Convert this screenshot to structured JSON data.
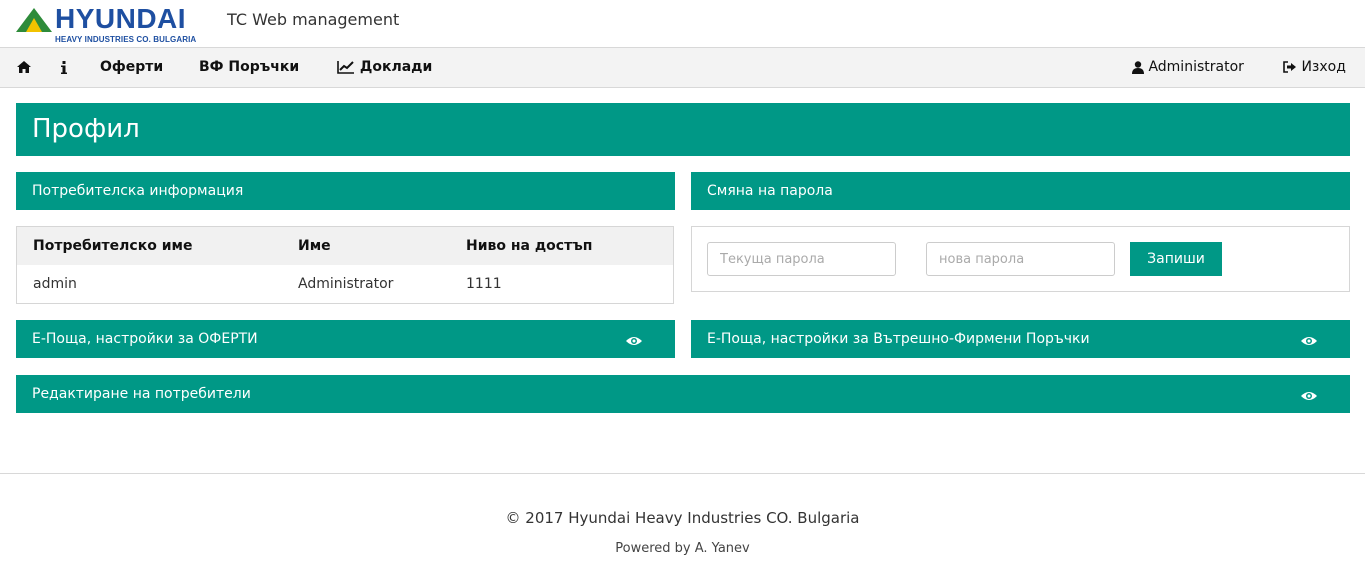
{
  "header": {
    "logo_text": "HYUNDAI",
    "logo_subtext": "HEAVY INDUSTRIES CO. BULGARIA",
    "app_title": "TC Web management",
    "brand_color": "#1e4fa1",
    "logo_accent_colors": [
      "#2e8b3a",
      "#f2c300"
    ]
  },
  "nav": {
    "home_icon": "home-icon",
    "info_icon": "info-icon",
    "offers": "Оферти",
    "orders": "ВФ Поръчки",
    "reports": "Доклади",
    "reports_icon": "line-chart-icon",
    "user": "Administrator",
    "user_icon": "user-icon",
    "logout": "Изход",
    "logout_icon": "logout-icon"
  },
  "page": {
    "title": "Профил",
    "accent_color": "#009886"
  },
  "user_info": {
    "heading": "Потребителска информация",
    "columns": [
      "Потребителско име",
      "Име",
      "Ниво на достъп"
    ],
    "row": [
      "admin",
      "Administrator",
      "1111"
    ]
  },
  "password": {
    "heading": "Смяна на парола",
    "current_placeholder": "Текуща парола",
    "new_placeholder": "нова парола",
    "save_label": "Запиши"
  },
  "sections": {
    "email_offers": "Е-Поща, настройки за ОФЕРТИ",
    "email_orders": "Е-Поща, настройки за Вътрешно-Фирмени Поръчки",
    "edit_users": "Редактиране на потребители",
    "toggle_icon": "eye-icon"
  },
  "footer": {
    "copyright": "© 2017 Hyundai Heavy Industries CO. Bulgaria",
    "powered": "Powered by A. Yanev"
  }
}
